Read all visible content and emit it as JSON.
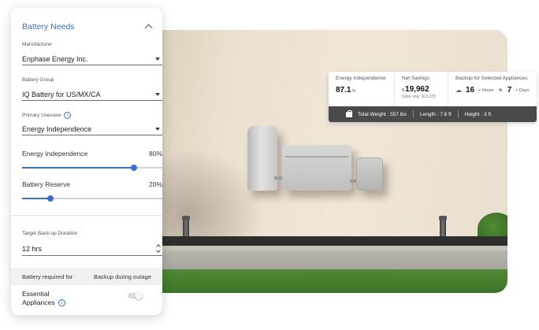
{
  "panel": {
    "title": "Battery Needs",
    "manufacturer": {
      "label": "Manufacturer",
      "value": "Enphase Energy Inc."
    },
    "battery_group": {
      "label": "Battery Group",
      "value": "IQ Battery for US/MX/CA"
    },
    "primary_usecase": {
      "label": "Primary Usecase",
      "value": "Energy Independence"
    },
    "energy_slider": {
      "label": "Energy Independence",
      "value_text": "80%",
      "value": 80
    },
    "reserve_slider": {
      "label": "Battery Reserve",
      "value_text": "20%",
      "value": 20
    },
    "backup_duration": {
      "label": "Target Back-up Duration",
      "value": "12 hrs"
    },
    "table": {
      "col1": "Battery required for",
      "col2": "Backup during outage"
    },
    "essential": {
      "label": "Essential Appliances",
      "enabled": false
    }
  },
  "stats": {
    "energy": {
      "label": "Energy Independence",
      "value": "87.1",
      "unit": "%"
    },
    "savings": {
      "label": "Net Savings",
      "currency": "$",
      "value": "19,962",
      "sub": "Solar only: $13,375"
    },
    "backup": {
      "label": "Backup for Selected Appliances",
      "hours_value": "16",
      "hours_unit": "+ Hours",
      "days_value": "7",
      "days_unit": "+ Days"
    },
    "bar": {
      "weight": "Total Weight : 557 lbs",
      "length": "Length : 7.6 ft",
      "height": "Height : 3 ft"
    }
  },
  "colors": {
    "accent": "#3a6fd8",
    "bar": "#4a4a4a"
  }
}
